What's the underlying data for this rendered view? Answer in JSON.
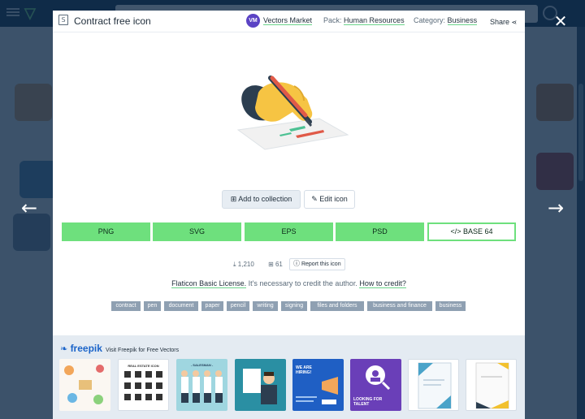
{
  "modal": {
    "title": "Contract free icon",
    "type_glyph": "S",
    "author": {
      "avatar_text": "VM",
      "name": "Vectors Market"
    },
    "pack": {
      "label": "Pack:",
      "value": "Human Resources"
    },
    "category": {
      "label": "Category:",
      "value": "Business"
    },
    "share_label": "Share",
    "actions": {
      "add_collection": "Add to collection",
      "edit_icon": "Edit icon"
    },
    "formats": [
      "PNG",
      "SVG",
      "EPS",
      "PSD",
      "</> BASE 64"
    ],
    "stats": {
      "downloads": "1,210",
      "collections": "61",
      "report": "Report this icon"
    },
    "license": {
      "name": "Flaticon Basic License.",
      "text": " It's necessary to credit the author. ",
      "credit_link": "How to credit?"
    },
    "tags": [
      "contract",
      "pen",
      "document",
      "paper",
      "pencil",
      "writing",
      "signing",
      "files and folders",
      "business and finance",
      "business"
    ],
    "freepik": {
      "brand": "freepik",
      "visit_text": "Visit Freepik for Free Vectors",
      "thumbs": [
        "REAL ESTATE ICON",
        "- SALESMAN -",
        "WE ARE HIRING!",
        "LOOKING FOR TALENT"
      ]
    }
  },
  "colors": {
    "accent_green": "#6ee07d",
    "overlay": "#0c2644",
    "tag_bg": "#8fa0b2",
    "freepik_blue": "#1b64c9"
  },
  "icons": {
    "prev": "arrow-left-icon",
    "next": "arrow-right-icon",
    "close": "close-icon",
    "share": "share-icon"
  }
}
